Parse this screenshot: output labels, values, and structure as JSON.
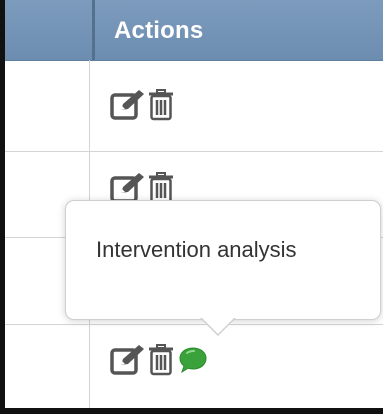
{
  "table": {
    "actions_header": "Actions",
    "header_color": "#7596ba",
    "rows": [
      {
        "actions": [
          "edit-icon",
          "trash-icon"
        ]
      },
      {
        "actions": [
          "edit-icon",
          "trash-icon"
        ]
      },
      {
        "actions": []
      },
      {
        "actions": [
          "edit-icon",
          "trash-icon",
          "comment-icon"
        ]
      }
    ]
  },
  "tooltip": {
    "text": "Intervention analysis"
  },
  "colors": {
    "icon": "#555555",
    "comment": "#3aa23a",
    "grid": "#d4d4d4"
  }
}
